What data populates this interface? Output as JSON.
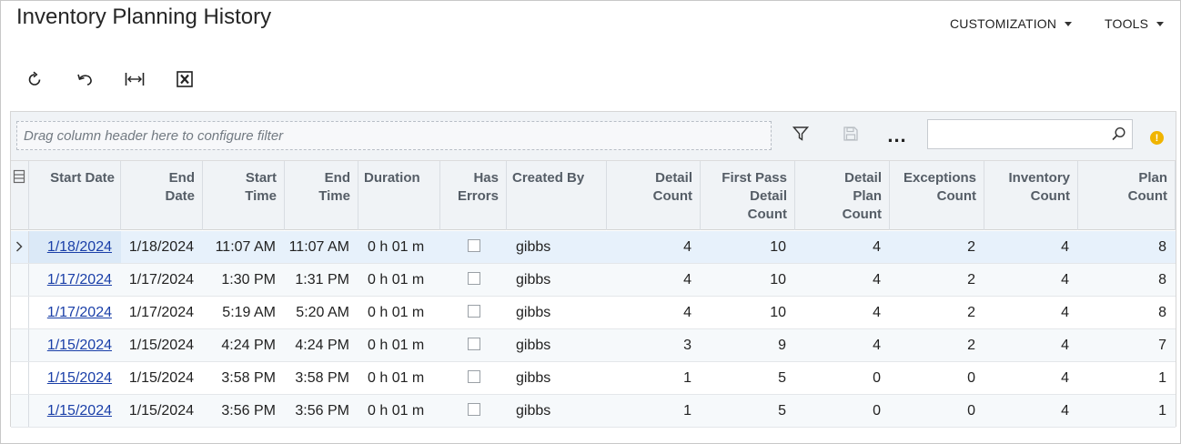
{
  "page": {
    "title": "Inventory Planning History"
  },
  "top_menu": {
    "customization": "CUSTOMIZATION",
    "tools": "TOOLS"
  },
  "toolbar": {
    "icons": [
      "refresh-icon",
      "undo-icon",
      "fit-columns-icon",
      "excel-export-icon"
    ]
  },
  "grid": {
    "filter_placeholder": "Drag column header here to configure filter",
    "more_label": "...",
    "search_value": "",
    "warning_label": "!",
    "columns": [
      {
        "key": "start_date",
        "lines": [
          "Start Date"
        ]
      },
      {
        "key": "end_date",
        "lines": [
          "End",
          "Date"
        ]
      },
      {
        "key": "start_time",
        "lines": [
          "Start",
          "Time"
        ]
      },
      {
        "key": "end_time",
        "lines": [
          "End",
          "Time"
        ]
      },
      {
        "key": "duration",
        "lines": [
          "Duration"
        ]
      },
      {
        "key": "has_errors",
        "lines": [
          "Has",
          "Errors"
        ]
      },
      {
        "key": "created_by",
        "lines": [
          "Created By"
        ]
      },
      {
        "key": "detail_count",
        "lines": [
          "Detail",
          "Count"
        ]
      },
      {
        "key": "first_pass_detail_count",
        "lines": [
          "First Pass",
          "Detail",
          "Count"
        ]
      },
      {
        "key": "detail_plan_count",
        "lines": [
          "Detail",
          "Plan",
          "Count"
        ]
      },
      {
        "key": "exceptions_count",
        "lines": [
          "Exceptions",
          "Count"
        ]
      },
      {
        "key": "inventory_count",
        "lines": [
          "Inventory",
          "Count"
        ]
      },
      {
        "key": "plan_count",
        "lines": [
          "Plan",
          "Count"
        ]
      }
    ],
    "rows": [
      {
        "start_date": "1/18/2024",
        "end_date": "1/18/2024",
        "start_time": "11:07 AM",
        "end_time": "11:07 AM",
        "duration": "0 h 01 m",
        "has_errors": false,
        "created_by": "gibbs",
        "detail_count": "4",
        "first_pass_detail_count": "10",
        "detail_plan_count": "4",
        "exceptions_count": "2",
        "inventory_count": "4",
        "plan_count": "8"
      },
      {
        "start_date": "1/17/2024",
        "end_date": "1/17/2024",
        "start_time": "1:30 PM",
        "end_time": "1:31 PM",
        "duration": "0 h 01 m",
        "has_errors": false,
        "created_by": "gibbs",
        "detail_count": "4",
        "first_pass_detail_count": "10",
        "detail_plan_count": "4",
        "exceptions_count": "2",
        "inventory_count": "4",
        "plan_count": "8"
      },
      {
        "start_date": "1/17/2024",
        "end_date": "1/17/2024",
        "start_time": "5:19 AM",
        "end_time": "5:20 AM",
        "duration": "0 h 01 m",
        "has_errors": false,
        "created_by": "gibbs",
        "detail_count": "4",
        "first_pass_detail_count": "10",
        "detail_plan_count": "4",
        "exceptions_count": "2",
        "inventory_count": "4",
        "plan_count": "8"
      },
      {
        "start_date": "1/15/2024",
        "end_date": "1/15/2024",
        "start_time": "4:24 PM",
        "end_time": "4:24 PM",
        "duration": "0 h 01 m",
        "has_errors": false,
        "created_by": "gibbs",
        "detail_count": "3",
        "first_pass_detail_count": "9",
        "detail_plan_count": "4",
        "exceptions_count": "2",
        "inventory_count": "4",
        "plan_count": "7"
      },
      {
        "start_date": "1/15/2024",
        "end_date": "1/15/2024",
        "start_time": "3:58 PM",
        "end_time": "3:58 PM",
        "duration": "0 h 01 m",
        "has_errors": false,
        "created_by": "gibbs",
        "detail_count": "1",
        "first_pass_detail_count": "5",
        "detail_plan_count": "0",
        "exceptions_count": "0",
        "inventory_count": "4",
        "plan_count": "1"
      },
      {
        "start_date": "1/15/2024",
        "end_date": "1/15/2024",
        "start_time": "3:56 PM",
        "end_time": "3:56 PM",
        "duration": "0 h 01 m",
        "has_errors": false,
        "created_by": "gibbs",
        "detail_count": "1",
        "first_pass_detail_count": "5",
        "detail_plan_count": "0",
        "exceptions_count": "0",
        "inventory_count": "4",
        "plan_count": "1"
      }
    ]
  },
  "colors": {
    "link": "#1a3fa8",
    "header_bg": "#f0f3f6",
    "selected_row": "#e7f1fb",
    "warning": "#f0b400"
  }
}
